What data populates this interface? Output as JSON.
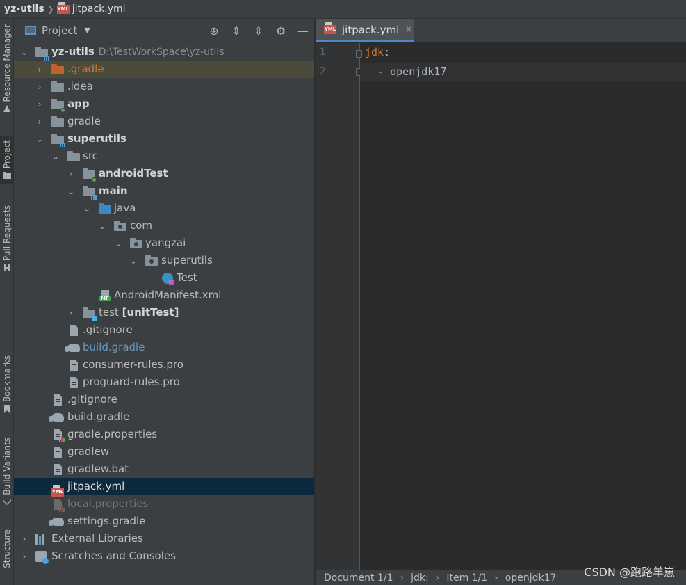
{
  "breadcrumb": {
    "root": "yz-utils",
    "file": "jitpack.yml",
    "file_icon": "yml-file-icon"
  },
  "left_stripe": {
    "tabs": [
      {
        "label": "Resource Manager"
      },
      {
        "label": "Project"
      },
      {
        "label": "Pull Requests"
      },
      {
        "label": "Bookmarks"
      },
      {
        "label": "Build Variants"
      },
      {
        "label": "Structure"
      }
    ]
  },
  "project_panel": {
    "title": "Project",
    "tools": [
      "locate-icon",
      "expand-all-icon",
      "collapse-all-icon",
      "gear-icon",
      "minimize-icon"
    ]
  },
  "tree": {
    "root_name": "yz-utils",
    "root_path": "D:\\TestWorkSpace\\yz-utils",
    "items": [
      {
        "label": ".gradle"
      },
      {
        "label": ".idea"
      },
      {
        "label": "app"
      },
      {
        "label": "gradle"
      },
      {
        "label": "superutils"
      },
      {
        "label": "src"
      },
      {
        "label": "androidTest"
      },
      {
        "label": "main"
      },
      {
        "label": "java"
      },
      {
        "label": "com"
      },
      {
        "label": "yangzai"
      },
      {
        "label": "superutils"
      },
      {
        "label": "Test"
      },
      {
        "label": "AndroidManifest.xml"
      },
      {
        "label": "test",
        "suffix": "[unitTest]"
      },
      {
        "label": ".gitignore"
      },
      {
        "label": "build.gradle"
      },
      {
        "label": "consumer-rules.pro"
      },
      {
        "label": "proguard-rules.pro"
      },
      {
        "label": ".gitignore"
      },
      {
        "label": "build.gradle"
      },
      {
        "label": "gradle.properties"
      },
      {
        "label": "gradlew"
      },
      {
        "label": "gradlew.bat"
      },
      {
        "label": "jitpack.yml"
      },
      {
        "label": "local.properties"
      },
      {
        "label": "settings.gradle"
      },
      {
        "label": "External Libraries"
      },
      {
        "label": "Scratches and Consoles"
      }
    ]
  },
  "editor": {
    "tab_label": "jitpack.yml",
    "lines": [
      {
        "num": "1",
        "key": "jdk",
        "rest": ":"
      },
      {
        "num": "2",
        "text": "  - openjdk17"
      }
    ]
  },
  "statusbar": {
    "items": [
      "Document 1/1",
      "jdk:",
      "Item 1/1",
      "openjdk17"
    ]
  },
  "watermark": "CSDN @跑路羊崽",
  "colors": {
    "accent": "#4a88c7",
    "selection": "#0d293e",
    "highlight": "#4b4a3b",
    "keyword": "#cc7832"
  }
}
